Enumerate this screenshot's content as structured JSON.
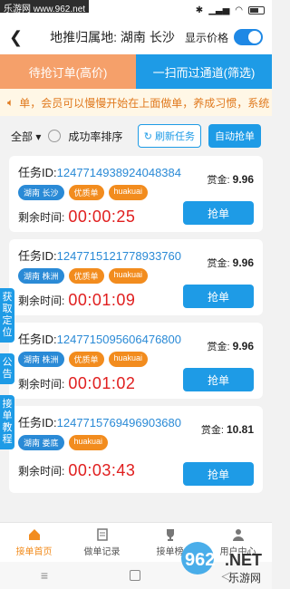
{
  "watermark_top": "乐游网 www.962.net",
  "status": {
    "time": ""
  },
  "header": {
    "title": "地推归属地: 湖南 长沙",
    "toggle_label": "显示价格"
  },
  "tabs": [
    {
      "label": "待抢订单(高价)"
    },
    {
      "label": "一扫而过通道(筛选)"
    }
  ],
  "notice": {
    "text": "单，会员可以慢慢开始在上面做单，养成习惯，系统"
  },
  "filter": {
    "all_label": "全部",
    "sort_label": "成功率排序",
    "refresh_label": "刷新任务",
    "auto_label": "自动抢单"
  },
  "cards": [
    {
      "id_label": "任务ID:",
      "id": "1247714938924048384",
      "bounty_label": "赏金:",
      "bounty": "9.96",
      "tags": [
        "湖南 长沙",
        "优质单",
        "huakuai"
      ],
      "remain_label": "剩余时间:",
      "time": "00:00:25",
      "button": "抢单"
    },
    {
      "id_label": "任务ID:",
      "id": "1247715121778933760",
      "bounty_label": "赏金:",
      "bounty": "9.96",
      "tags": [
        "湖南 株洲",
        "优质单",
        "huakuai"
      ],
      "remain_label": "剩余时间:",
      "time": "00:01:09",
      "button": "抢单"
    },
    {
      "id_label": "任务ID:",
      "id": "1247715095606476800",
      "bounty_label": "赏金:",
      "bounty": "9.96",
      "tags": [
        "湖南 株洲",
        "优质单",
        "huakuai"
      ],
      "remain_label": "剩余时间:",
      "time": "00:01:02",
      "button": "抢单"
    },
    {
      "id_label": "任务ID:",
      "id": "1247715769496903680",
      "bounty_label": "赏金:",
      "bounty": "10.81",
      "tags": [
        "湖南 娄底",
        "huakuai"
      ],
      "remain_label": "剩余时间:",
      "time": "00:03:43",
      "button": "抢单"
    }
  ],
  "side_tabs": [
    "获取定位",
    "公告",
    "接单教程"
  ],
  "nav": [
    {
      "label": "接单首页"
    },
    {
      "label": "做单记录"
    },
    {
      "label": "接单榜"
    },
    {
      "label": "用户中心"
    }
  ],
  "watermark": {
    "brand": "962",
    "suffix": ".NET",
    "sub": "乐游网"
  },
  "colors": {
    "primary": "#1e9be6",
    "orange": "#f28c1e",
    "red": "#e01e1e",
    "tab_orange": "#f5a06a"
  }
}
